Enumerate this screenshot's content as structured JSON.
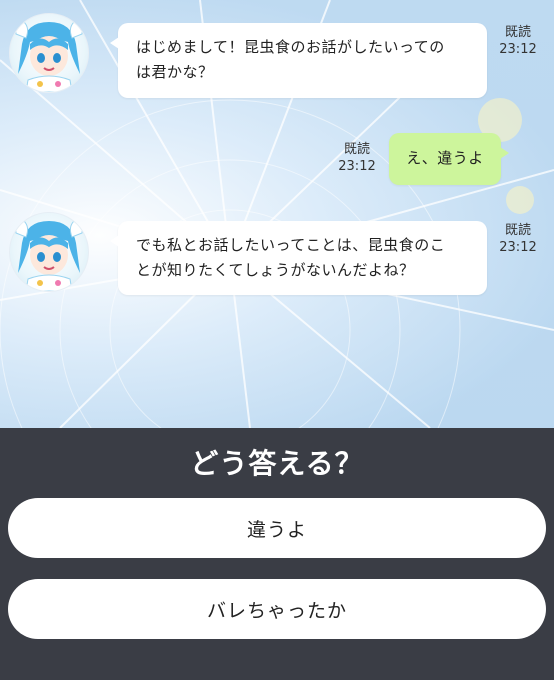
{
  "messages": [
    {
      "side": "left",
      "line1": "はじめまして！昆虫食のお話がしたいっての",
      "line2": "は君かな？",
      "read": "既読",
      "time": "23:12"
    },
    {
      "side": "right",
      "text": "え、違うよ",
      "read": "既読",
      "time": "23:12"
    },
    {
      "side": "left",
      "line1": "でも私とお話したいってことは、昆虫食のこ",
      "line2": "とが知りたくてしょうがないんだよね？",
      "read": "既読",
      "time": "23:12"
    }
  ],
  "answer_panel": {
    "question": "どう答える？",
    "choices": [
      "違うよ",
      "バレちゃったか"
    ]
  },
  "colors": {
    "panel_bg": "#3a3d45",
    "user_bubble": "#cdf59c",
    "character_hair": "#4cb3e8"
  }
}
